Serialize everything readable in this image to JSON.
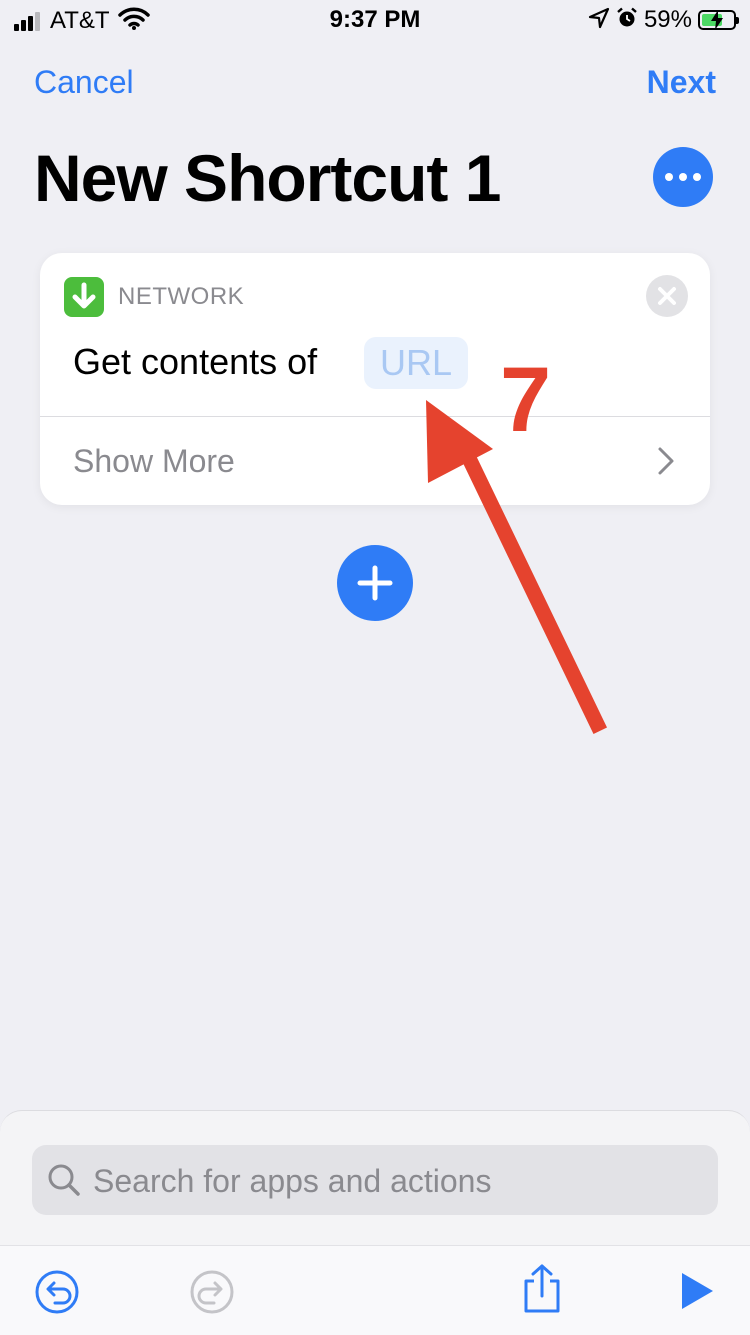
{
  "status_bar": {
    "carrier": "AT&T",
    "time": "9:37 PM",
    "battery": "59%",
    "icons": [
      "signal-icon",
      "wifi-icon",
      "location-icon",
      "alarm-icon",
      "battery-charging-icon"
    ]
  },
  "nav": {
    "cancel_label": "Cancel",
    "next_label": "Next",
    "title": "New Shortcut 1"
  },
  "action_card": {
    "category": "NETWORK",
    "action_text": "Get contents of",
    "token": "URL",
    "show_more": "Show More",
    "icon_color": "#4cbd3c"
  },
  "annotation": {
    "step_number": "7",
    "color": "#e5432e"
  },
  "search": {
    "placeholder": "Search for apps and actions"
  },
  "toolbar": {
    "icons": [
      "undo-icon",
      "redo-icon",
      "share-icon",
      "play-icon"
    ]
  },
  "colors": {
    "accent": "#2f7cf6",
    "background": "#efeff4"
  }
}
